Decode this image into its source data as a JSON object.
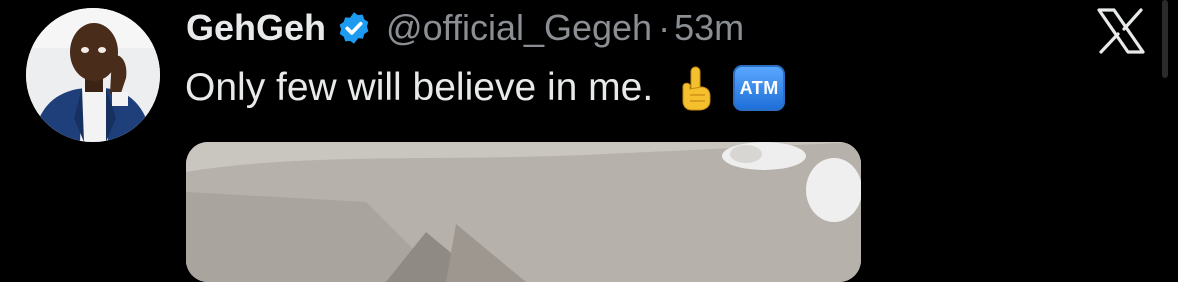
{
  "tweet": {
    "display_name": "GehGeh",
    "handle": "@official_Gegeh",
    "separator": "·",
    "timestamp": "53m",
    "text": "Only few will believe in me.",
    "emoji_atm": "ATM"
  },
  "icons": {
    "verified": "verified-badge-icon",
    "finger": "index-pointing-up-emoji",
    "atm": "atm-sign-emoji",
    "logo": "x-logo-icon"
  },
  "colors": {
    "background": "#000000",
    "name": "#e7e9ea",
    "secondary": "#8b8f94",
    "verified": "#1d9bf0"
  }
}
